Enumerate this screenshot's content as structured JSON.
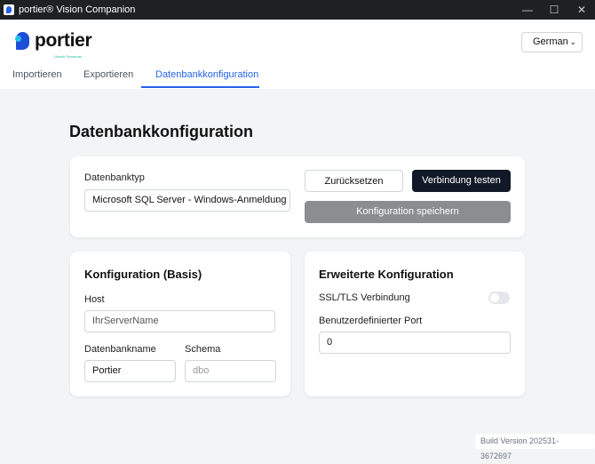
{
  "window": {
    "title": "portier® Vision Companion",
    "minimize": "—",
    "maximize": "☐",
    "close": "✕"
  },
  "logo": {
    "word": "portier",
    "tagline": "Unlock Tomorrow"
  },
  "language": {
    "selected": "German"
  },
  "tabs": [
    {
      "label": "Importieren"
    },
    {
      "label": "Exportieren"
    },
    {
      "label": "Datenbankkonfiguration",
      "active": true
    }
  ],
  "page_title": "Datenbankkonfiguration",
  "dbtype": {
    "label": "Datenbanktyp",
    "value": "Microsoft SQL Server - Windows-Anmeldung",
    "reset": "Zurücksetzen",
    "test": "Verbindung testen",
    "save": "Konfiguration speichern"
  },
  "basic": {
    "title": "Konfiguration (Basis)",
    "host_label": "Host",
    "host_placeholder": "IhrServerName",
    "dbname_label": "Datenbankname",
    "dbname_value": "Portier",
    "schema_label": "Schema",
    "schema_placeholder": "dbo"
  },
  "advanced": {
    "title": "Erweiterte Konfiguration",
    "ssl_label": "SSL/TLS Verbindung",
    "ssl_enabled": false,
    "port_label": "Benutzerdefinierter Port",
    "port_value": "0"
  },
  "build": "Build Version 202531-3672697",
  "colors": {
    "accent": "#2563eb",
    "dark_button": "#111827",
    "disabled_button": "#8b8d91"
  }
}
